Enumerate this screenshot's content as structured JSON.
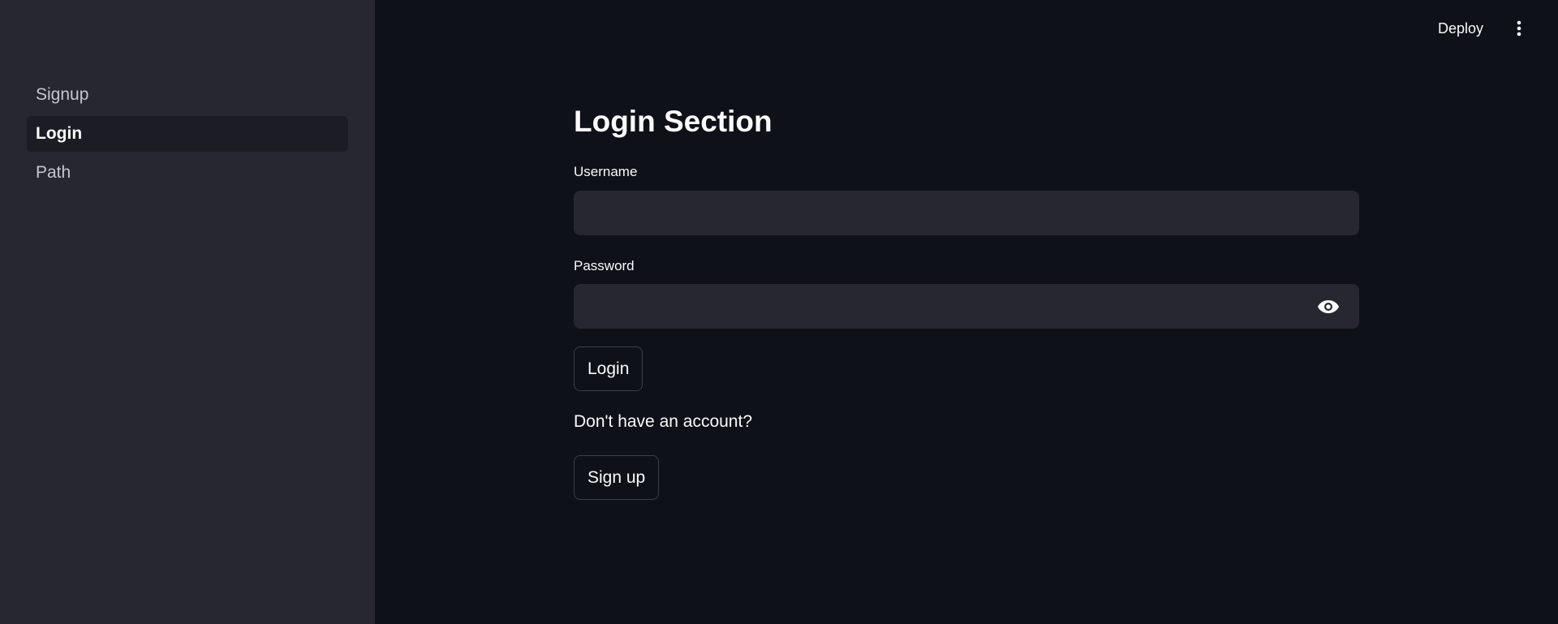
{
  "sidebar": {
    "items": [
      {
        "label": "Signup",
        "active": false
      },
      {
        "label": "Login",
        "active": true
      },
      {
        "label": "Path",
        "active": false
      }
    ]
  },
  "header": {
    "deploy_label": "Deploy",
    "menu_icon": "kebab-menu-icon"
  },
  "main": {
    "title": "Login Section",
    "username": {
      "label": "Username",
      "value": "",
      "placeholder": ""
    },
    "password": {
      "label": "Password",
      "value": "",
      "placeholder": "",
      "toggle_icon": "eye-icon"
    },
    "login_button": "Login",
    "signup_prompt": "Don't have an account?",
    "signup_button": "Sign up"
  },
  "colors": {
    "background": "#0e1117",
    "sidebar": "#262730",
    "input": "#262730",
    "text": "#fafafa"
  }
}
